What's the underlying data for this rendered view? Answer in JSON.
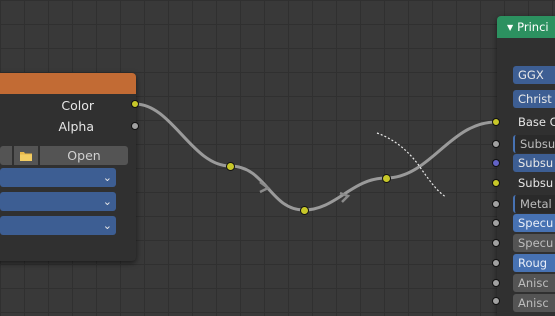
{
  "left_node": {
    "outputs": {
      "color": "Color",
      "alpha": "Alpha"
    },
    "open_button": "Open",
    "dropdowns": [
      "",
      "",
      ""
    ],
    "header_color": "#c26b34"
  },
  "principled_node": {
    "title": "Princi",
    "header_color": "#2c9160",
    "rows": {
      "distribution": "GGX",
      "subsurface_method": "Christ",
      "base_color": "Base C",
      "subsurface": "Subsu",
      "subsurface_radius": "Subsu",
      "subsurface_color": "Subsu",
      "metallic": "Metal",
      "specular": "Specu",
      "specular_tint": "Specu",
      "roughness": "Roug",
      "anisotropic": "Anisc",
      "anisotropic_rotation": "Anisc"
    }
  },
  "socket_colors": {
    "color": "#c7c729",
    "float": "#a1a1a1",
    "vector": "#6363c7"
  },
  "link_color": "#9a9a9a",
  "icons": [
    "folder-icon",
    "chevron-down-icon",
    "collapse-triangle-icon"
  ]
}
